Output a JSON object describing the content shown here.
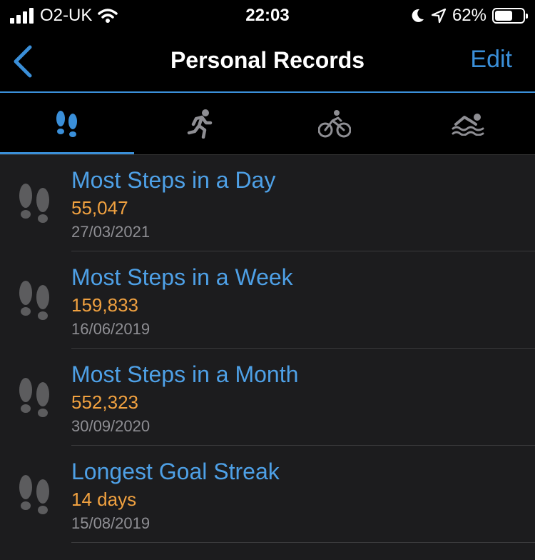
{
  "status": {
    "carrier": "O2-UK",
    "time": "22:03",
    "battery": "62%",
    "battery_level": 0.62
  },
  "nav": {
    "title": "Personal Records",
    "edit_label": "Edit"
  },
  "tabs": [
    {
      "icon": "footsteps-icon",
      "active": true
    },
    {
      "icon": "running-icon",
      "active": false
    },
    {
      "icon": "cycling-icon",
      "active": false
    },
    {
      "icon": "swimming-icon",
      "active": false
    }
  ],
  "records": [
    {
      "name": "Most Steps in a Day",
      "value": "55,047",
      "date": "27/03/2021"
    },
    {
      "name": "Most Steps in a Week",
      "value": "159,833",
      "date": "16/06/2019"
    },
    {
      "name": "Most Steps in a Month",
      "value": "552,323",
      "date": "30/09/2020"
    },
    {
      "name": "Longest Goal Streak",
      "value": "14 days",
      "date": "15/08/2019"
    }
  ],
  "colors": {
    "accent": "#3a8fd9",
    "value": "#f0a140",
    "date": "#8e8e93",
    "background": "#1c1c1e"
  }
}
